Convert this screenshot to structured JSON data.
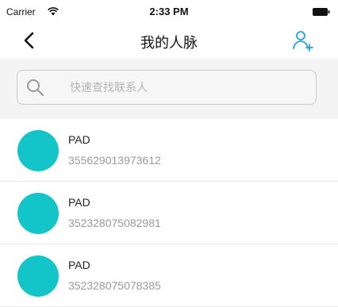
{
  "status_bar": {
    "carrier": "Carrier",
    "time": "2:33 PM"
  },
  "nav": {
    "title": "我的人脉",
    "back_icon": "chevron-left-icon",
    "add_icon": "add-contact-icon",
    "accent": "#1aa5e8"
  },
  "search": {
    "placeholder": "快速查找联系人",
    "value": ""
  },
  "contacts": [
    {
      "name": "PAD",
      "id": "355629013973612"
    },
    {
      "name": "PAD",
      "id": "352328075082981"
    },
    {
      "name": "PAD",
      "id": "352328075078385"
    }
  ],
  "avatar_color": "#13c4c9"
}
